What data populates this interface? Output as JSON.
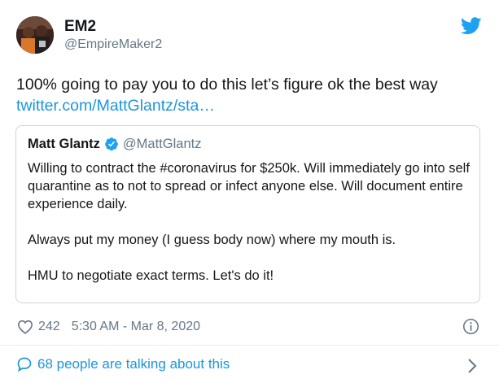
{
  "author": {
    "name": "EM2",
    "handle": "@EmpireMaker2"
  },
  "tweet": {
    "text": "100% going to pay you to do this let’s figure ok the best way",
    "link": "twitter.com/MattGlantz/sta…"
  },
  "quoted_tweet": {
    "name": "Matt Glantz",
    "handle": "@MattGlantz",
    "paragraphs": [
      "Willing to contract the #coronavirus for $250k.  Will immediately go into self quarantine as to not to spread or infect anyone else. Will document entire experience daily.",
      "Always put my money (I guess body now) where my mouth is.",
      "HMU to negotiate exact terms. Let's do it!"
    ]
  },
  "meta": {
    "likes": "242",
    "timestamp": "5:30 AM - Mar 8, 2020"
  },
  "conversation": {
    "label": "68 people are talking about this"
  },
  "icons": {
    "brand": "twitter-bird-icon",
    "verified": "verified-badge-icon",
    "like": "heart-icon",
    "info": "info-icon",
    "talk": "speech-bubble-icon",
    "chevron": "chevron-right-icon"
  },
  "colors": {
    "brand_blue": "#1da1f2",
    "link_blue": "#1b95e0",
    "secondary_text": "#657786",
    "border": "#ccd6dd"
  }
}
